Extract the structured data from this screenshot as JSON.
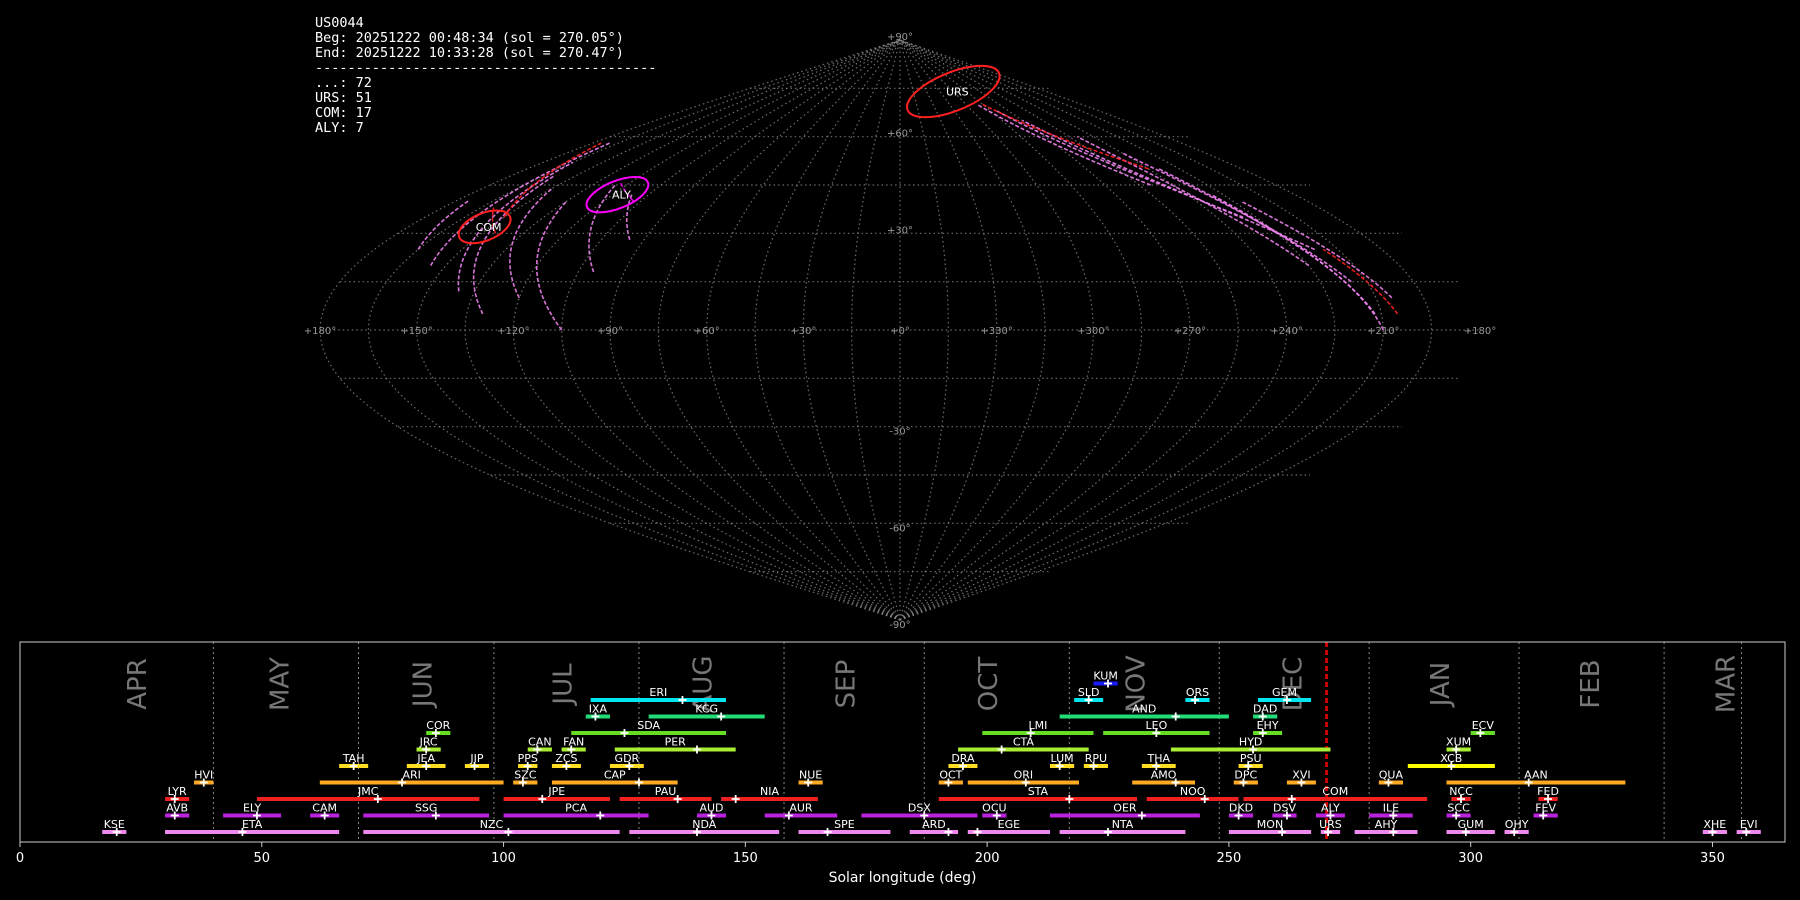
{
  "info": {
    "station": "US0044",
    "begin": "Beg: 20251222 00:48:34 (sol = 270.05°)",
    "end": "End: 20251222 10:33:28 (sol = 270.47°)",
    "separator": "------------------------------------------",
    "counts": [
      "...: 72",
      "URS: 51",
      "COM: 17",
      "ALY: 7"
    ]
  },
  "colors": {
    "spo": "#ee82ee",
    "urs": "#ff2020",
    "com": "#ff2020",
    "aly": "#ff00ff",
    "grid": "#888888"
  },
  "chart_data": [
    {
      "type": "scatter",
      "projection": "sinusoidal",
      "lon_tick_labels": [
        "+180°",
        "+150°",
        "+120°",
        "+90°",
        "+60°",
        "+30°",
        "+0°",
        "+330°",
        "+300°",
        "+270°",
        "+240°",
        "+210°",
        "+180°"
      ],
      "lat_tick_labels": [
        "+90°",
        "+60°",
        "+30°",
        "-30°",
        "-60°",
        "-90°"
      ],
      "radiants": [
        {
          "name": "URS",
          "lon": 300,
          "lat": 74,
          "rx": 9,
          "ry": 3.5,
          "color": "#ff2020"
        },
        {
          "name": "COM",
          "lon": 152,
          "lat": 32,
          "rx": 5,
          "ry": 2.5,
          "color": "#ff2020"
        },
        {
          "name": "ALY",
          "lon": 118,
          "lat": 42,
          "rx": 6,
          "ry": 2.5,
          "color": "#ff00ff"
        }
      ]
    },
    {
      "type": "gantt",
      "xlabel": "Solar longitude (deg)",
      "xlim": [
        0,
        365
      ],
      "xticks": [
        0,
        50,
        100,
        150,
        200,
        250,
        300,
        350
      ],
      "current_sol": 270.2,
      "months": [
        {
          "name": "APR",
          "center": 24.5,
          "end": 40
        },
        {
          "name": "MAY",
          "center": 54,
          "end": 70
        },
        {
          "name": "JUN",
          "center": 83.5,
          "end": 98
        },
        {
          "name": "JUL",
          "center": 112.5,
          "end": 128
        },
        {
          "name": "AUG",
          "center": 141.5,
          "end": 158
        },
        {
          "name": "SEP",
          "center": 171,
          "end": 187
        },
        {
          "name": "OCT",
          "center": 200.5,
          "end": 217
        },
        {
          "name": "NOV",
          "center": 231,
          "end": 248
        },
        {
          "name": "DEC",
          "center": 263.5,
          "end": 279
        },
        {
          "name": "JAN",
          "center": 294,
          "end": 310
        },
        {
          "name": "FEB",
          "center": 325,
          "end": 340
        },
        {
          "name": "MAR",
          "center": 353,
          "end": 356
        }
      ],
      "showers": [
        {
          "code": "KUM",
          "start": 222,
          "end": 227,
          "peak": 225,
          "row": 8,
          "color": "#1a1aff"
        },
        {
          "code": "ERI",
          "start": 118,
          "end": 146,
          "peak": 137,
          "row": 7,
          "color": "#00e5ee"
        },
        {
          "code": "SLD",
          "start": 218,
          "end": 224,
          "peak": 221,
          "row": 7,
          "color": "#00e5ee"
        },
        {
          "code": "ORS",
          "start": 241,
          "end": 246,
          "peak": 243,
          "row": 7,
          "color": "#00e5ee"
        },
        {
          "code": "GEM",
          "start": 256,
          "end": 267,
          "peak": 262,
          "row": 7,
          "color": "#00e5ee"
        },
        {
          "code": "IXA",
          "start": 117,
          "end": 122,
          "peak": 119,
          "row": 6,
          "color": "#22dd77"
        },
        {
          "code": "KCG",
          "start": 130,
          "end": 154,
          "peak": 145,
          "row": 6,
          "color": "#22dd77"
        },
        {
          "code": "AND",
          "start": 215,
          "end": 250,
          "peak": 239,
          "row": 6,
          "color": "#22dd77"
        },
        {
          "code": "DAD",
          "start": 255,
          "end": 260,
          "peak": 257,
          "row": 6,
          "color": "#22dd77"
        },
        {
          "code": "COR",
          "start": 84,
          "end": 89,
          "peak": 86,
          "row": 5,
          "color": "#66dd22"
        },
        {
          "code": "SDA",
          "start": 114,
          "end": 146,
          "peak": 125,
          "row": 5,
          "color": "#66dd22"
        },
        {
          "code": "LMI",
          "start": 199,
          "end": 222,
          "peak": 209,
          "row": 5,
          "color": "#66dd22"
        },
        {
          "code": "LEO",
          "start": 224,
          "end": 246,
          "peak": 235,
          "row": 5,
          "color": "#66dd22"
        },
        {
          "code": "EHY",
          "start": 255,
          "end": 261,
          "peak": 257,
          "row": 5,
          "color": "#66dd22"
        },
        {
          "code": "ECV",
          "start": 300,
          "end": 305,
          "peak": 302,
          "row": 5,
          "color": "#66dd22"
        },
        {
          "code": "JRC",
          "start": 82,
          "end": 87,
          "peak": 84,
          "row": 4,
          "color": "#aaee33"
        },
        {
          "code": "CAN",
          "start": 105,
          "end": 110,
          "peak": 107,
          "row": 4,
          "color": "#aaee33"
        },
        {
          "code": "FAN",
          "start": 112,
          "end": 117,
          "peak": 114,
          "row": 4,
          "color": "#aaee33"
        },
        {
          "code": "PER",
          "start": 123,
          "end": 148,
          "peak": 140,
          "row": 4,
          "color": "#aaee33"
        },
        {
          "code": "CTA",
          "start": 194,
          "end": 221,
          "peak": 203,
          "row": 4,
          "color": "#aaee33"
        },
        {
          "code": "HYD",
          "start": 238,
          "end": 271,
          "peak": 255,
          "row": 4,
          "color": "#aaee33"
        },
        {
          "code": "XUM",
          "start": 295,
          "end": 300,
          "peak": 297,
          "row": 4,
          "color": "#aaee33"
        },
        {
          "code": "TAH",
          "start": 66,
          "end": 72,
          "peak": 69,
          "row": 3,
          "color": "#ffdd22"
        },
        {
          "code": "JEA",
          "start": 80,
          "end": 88,
          "peak": 84,
          "row": 3,
          "color": "#ffdd22"
        },
        {
          "code": "JIP",
          "start": 92,
          "end": 97,
          "peak": 94,
          "row": 3,
          "color": "#ffdd22"
        },
        {
          "code": "PPS",
          "start": 103,
          "end": 107,
          "peak": 105,
          "row": 3,
          "color": "#ffdd22"
        },
        {
          "code": "ZCS",
          "start": 110,
          "end": 116,
          "peak": 113,
          "row": 3,
          "color": "#ffdd22"
        },
        {
          "code": "GDR",
          "start": 122,
          "end": 129,
          "peak": 126,
          "row": 3,
          "color": "#ffdd22"
        },
        {
          "code": "DRA",
          "start": 192,
          "end": 198,
          "peak": 195,
          "row": 3,
          "color": "#ffdd22"
        },
        {
          "code": "LUM",
          "start": 213,
          "end": 218,
          "peak": 215,
          "row": 3,
          "color": "#ffdd22"
        },
        {
          "code": "RPU",
          "start": 220,
          "end": 225,
          "peak": 222,
          "row": 3,
          "color": "#ffdd22"
        },
        {
          "code": "THA",
          "start": 232,
          "end": 239,
          "peak": 235,
          "row": 3,
          "color": "#ffdd22"
        },
        {
          "code": "PSU",
          "start": 252,
          "end": 257,
          "peak": 254,
          "row": 3,
          "color": "#ffdd22"
        },
        {
          "code": "XCB",
          "start": 287,
          "end": 305,
          "peak": 296,
          "row": 3,
          "color": "#ffff00"
        },
        {
          "code": "HVI",
          "start": 36,
          "end": 40,
          "peak": 38,
          "row": 2,
          "color": "#ffaa22"
        },
        {
          "code": "ARI",
          "start": 62,
          "end": 100,
          "peak": 79,
          "row": 2,
          "color": "#ffaa22"
        },
        {
          "code": "SZC",
          "start": 102,
          "end": 107,
          "peak": 104,
          "row": 2,
          "color": "#ffaa22"
        },
        {
          "code": "CAP",
          "start": 110,
          "end": 136,
          "peak": 128,
          "row": 2,
          "color": "#ffaa22"
        },
        {
          "code": "NUE",
          "start": 161,
          "end": 166,
          "peak": 163,
          "row": 2,
          "color": "#ffaa22"
        },
        {
          "code": "OCT",
          "start": 190,
          "end": 195,
          "peak": 192,
          "row": 2,
          "color": "#ffaa22"
        },
        {
          "code": "ORI",
          "start": 196,
          "end": 219,
          "peak": 208,
          "row": 2,
          "color": "#ffaa22"
        },
        {
          "code": "AMO",
          "start": 230,
          "end": 243,
          "peak": 239,
          "row": 2,
          "color": "#ffaa22"
        },
        {
          "code": "DPC",
          "start": 251,
          "end": 256,
          "peak": 253,
          "row": 2,
          "color": "#ffaa22"
        },
        {
          "code": "XVI",
          "start": 262,
          "end": 268,
          "peak": 265,
          "row": 2,
          "color": "#ffaa22"
        },
        {
          "code": "QUA",
          "start": 281,
          "end": 286,
          "peak": 283,
          "row": 2,
          "color": "#ffaa22"
        },
        {
          "code": "AAN",
          "start": 295,
          "end": 332,
          "peak": 312,
          "row": 2,
          "color": "#ffaa22"
        },
        {
          "code": "LYR",
          "start": 30,
          "end": 35,
          "peak": 32,
          "row": 1,
          "color": "#ee2020"
        },
        {
          "code": "JMC",
          "start": 49,
          "end": 95,
          "peak": 74,
          "row": 1,
          "color": "#ee2020"
        },
        {
          "code": "JPE",
          "start": 100,
          "end": 122,
          "peak": 108,
          "row": 1,
          "color": "#ee2020"
        },
        {
          "code": "PAU",
          "start": 124,
          "end": 143,
          "peak": 136,
          "row": 1,
          "color": "#ee2020"
        },
        {
          "code": "NIA",
          "start": 145,
          "end": 165,
          "peak": 148,
          "row": 1,
          "color": "#ee2020"
        },
        {
          "code": "STA",
          "start": 190,
          "end": 231,
          "peak": 217,
          "row": 1,
          "color": "#ee2020"
        },
        {
          "code": "NOO",
          "start": 233,
          "end": 252,
          "peak": 245,
          "row": 1,
          "color": "#ee2020"
        },
        {
          "code": "COM",
          "start": 253,
          "end": 291,
          "peak": 263,
          "row": 1,
          "color": "#ee2020"
        },
        {
          "code": "NCC",
          "start": 296,
          "end": 300,
          "peak": 298,
          "row": 1,
          "color": "#ee2020"
        },
        {
          "code": "FED",
          "start": 314,
          "end": 318,
          "peak": 316,
          "row": 1,
          "color": "#ee2020"
        },
        {
          "code": "AVB",
          "start": 30,
          "end": 35,
          "peak": 32,
          "row": 0,
          "color": "#bb22dd"
        },
        {
          "code": "ELY",
          "start": 42,
          "end": 54,
          "peak": 49,
          "row": 0,
          "color": "#bb22dd"
        },
        {
          "code": "CAM",
          "start": 60,
          "end": 66,
          "peak": 63,
          "row": 0,
          "color": "#bb22dd"
        },
        {
          "code": "SSG",
          "start": 71,
          "end": 97,
          "peak": 86,
          "row": 0,
          "color": "#bb22dd"
        },
        {
          "code": "PCA",
          "start": 100,
          "end": 130,
          "peak": 120,
          "row": 0,
          "color": "#bb22dd"
        },
        {
          "code": "AUD",
          "start": 140,
          "end": 146,
          "peak": 143,
          "row": 0,
          "color": "#bb22dd"
        },
        {
          "code": "AUR",
          "start": 154,
          "end": 169,
          "peak": 159,
          "row": 0,
          "color": "#bb22dd"
        },
        {
          "code": "DSX",
          "start": 174,
          "end": 198,
          "peak": 187,
          "row": 0,
          "color": "#bb22dd"
        },
        {
          "code": "OCU",
          "start": 199,
          "end": 204,
          "peak": 202,
          "row": 0,
          "color": "#bb22dd"
        },
        {
          "code": "OER",
          "start": 213,
          "end": 244,
          "peak": 232,
          "row": 0,
          "color": "#bb22dd"
        },
        {
          "code": "DKD",
          "start": 250,
          "end": 255,
          "peak": 252,
          "row": 0,
          "color": "#bb22dd"
        },
        {
          "code": "DSV",
          "start": 259,
          "end": 264,
          "peak": 262,
          "row": 0,
          "color": "#bb22dd"
        },
        {
          "code": "ALY",
          "start": 268,
          "end": 274,
          "peak": 271,
          "row": 0,
          "color": "#bb22dd"
        },
        {
          "code": "ILE",
          "start": 279,
          "end": 288,
          "peak": 284,
          "row": 0,
          "color": "#bb22dd"
        },
        {
          "code": "SCC",
          "start": 295,
          "end": 300,
          "peak": 297,
          "row": 0,
          "color": "#bb22dd"
        },
        {
          "code": "FEV",
          "start": 313,
          "end": 318,
          "peak": 315,
          "row": 0,
          "color": "#bb22dd"
        },
        {
          "code": "KSE",
          "start": 17,
          "end": 22,
          "peak": 20,
          "row": -1,
          "color": "#ee88ee"
        },
        {
          "code": "ETA",
          "start": 30,
          "end": 66,
          "peak": 46,
          "row": -1,
          "color": "#ee88ee"
        },
        {
          "code": "NZC",
          "start": 71,
          "end": 124,
          "peak": 101,
          "row": -1,
          "color": "#ee88ee"
        },
        {
          "code": "NDA",
          "start": 126,
          "end": 157,
          "peak": 140,
          "row": -1,
          "color": "#ee88ee"
        },
        {
          "code": "SPE",
          "start": 161,
          "end": 180,
          "peak": 167,
          "row": -1,
          "color": "#ee88ee"
        },
        {
          "code": "ARD",
          "start": 184,
          "end": 194,
          "peak": 192,
          "row": -1,
          "color": "#ee88ee"
        },
        {
          "code": "EGE",
          "start": 196,
          "end": 213,
          "peak": 198,
          "row": -1,
          "color": "#ee88ee"
        },
        {
          "code": "NTA",
          "start": 215,
          "end": 241,
          "peak": 225,
          "row": -1,
          "color": "#ee88ee"
        },
        {
          "code": "MON",
          "start": 250,
          "end": 267,
          "peak": 261,
          "row": -1,
          "color": "#ee88ee"
        },
        {
          "code": "URS",
          "start": 269,
          "end": 273,
          "peak": 270.5,
          "row": -1,
          "color": "#ee88ee"
        },
        {
          "code": "AHY",
          "start": 276,
          "end": 289,
          "peak": 284,
          "row": -1,
          "color": "#ee88ee"
        },
        {
          "code": "GUM",
          "start": 295,
          "end": 305,
          "peak": 299,
          "row": -1,
          "color": "#ee88ee"
        },
        {
          "code": "OHY",
          "start": 307,
          "end": 312,
          "peak": 309,
          "row": -1,
          "color": "#ee88ee"
        },
        {
          "code": "XHE",
          "start": 348,
          "end": 353,
          "peak": 350,
          "row": -1,
          "color": "#ee88ee"
        },
        {
          "code": "EVI",
          "start": 355,
          "end": 360,
          "peak": 357,
          "row": -1,
          "color": "#ee88ee"
        }
      ]
    }
  ]
}
